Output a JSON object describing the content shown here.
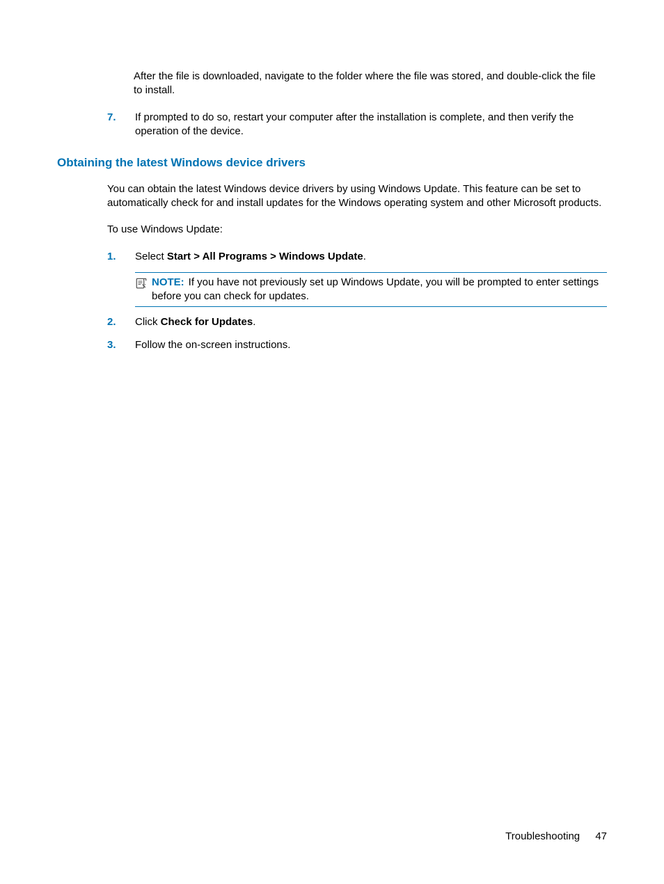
{
  "top_block": {
    "para1": "After the file is downloaded, navigate to the folder where the file was stored, and double-click the file to install.",
    "step7_num": "7.",
    "step7_text": "If prompted to do so, restart your computer after the installation is complete, and then verify the operation of the device."
  },
  "heading": "Obtaining the latest Windows device drivers",
  "section": {
    "intro": "You can obtain the latest Windows device drivers by using Windows Update. This feature can be set to automatically check for and install updates for the Windows operating system and other Microsoft products.",
    "lead": "To use Windows Update:",
    "steps": {
      "s1_num": "1.",
      "s1_pre": "Select ",
      "s1_bold": "Start > All Programs > Windows Update",
      "s1_post": ".",
      "note_label": "NOTE:",
      "note_text": "If you have not previously set up Windows Update, you will be prompted to enter settings before you can check for updates.",
      "s2_num": "2.",
      "s2_pre": "Click ",
      "s2_bold": "Check for Updates",
      "s2_post": ".",
      "s3_num": "3.",
      "s3_text": "Follow the on-screen instructions."
    }
  },
  "footer": {
    "section": "Troubleshooting",
    "page": "47"
  }
}
